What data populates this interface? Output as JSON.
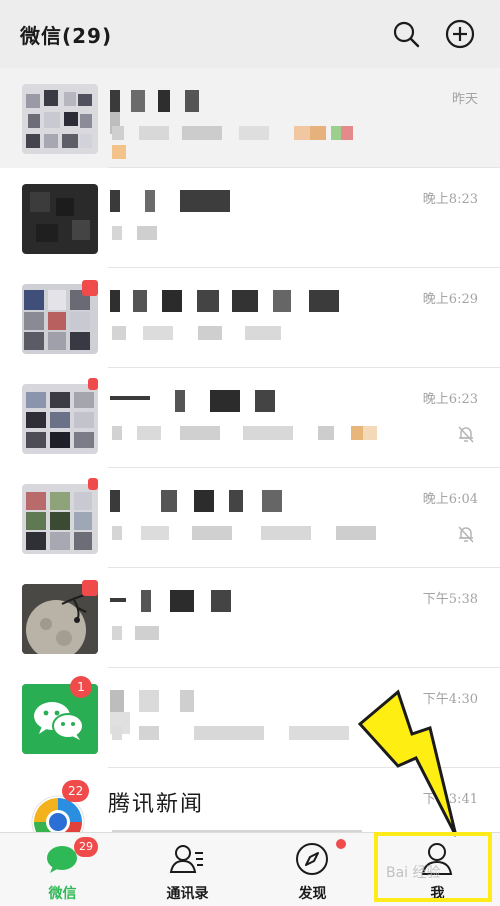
{
  "header": {
    "title": "微信(29)",
    "search_icon": "search-icon",
    "add_icon": "plus-circle-icon"
  },
  "chats": [
    {
      "time": "昨天",
      "pinned": true,
      "muted": false
    },
    {
      "time": "晚上8:23",
      "pinned": false,
      "muted": false
    },
    {
      "time": "晚上6:29",
      "pinned": false,
      "muted": false
    },
    {
      "time": "晚上6:23",
      "pinned": false,
      "muted": true
    },
    {
      "time": "晚上6:04",
      "pinned": false,
      "muted": true
    },
    {
      "time": "下午5:38",
      "pinned": false,
      "muted": false
    },
    {
      "time": "下午4:30",
      "pinned": false,
      "muted": false,
      "badge": "1"
    },
    {
      "time": "下午3:41",
      "pinned": false,
      "muted": false,
      "badge": "22",
      "name": "腾讯新闻"
    }
  ],
  "tabbar": {
    "tabs": [
      {
        "label": "微信",
        "icon": "chat-bubble-icon",
        "badge": "29",
        "active": true
      },
      {
        "label": "通讯录",
        "icon": "contacts-icon"
      },
      {
        "label": "发现",
        "icon": "compass-icon",
        "dot": true
      },
      {
        "label": "我",
        "icon": "person-icon"
      }
    ]
  },
  "watermark": "Bai 经验",
  "colors": {
    "accent_green": "#2fb856",
    "badge_red": "#f04b4b",
    "highlight_yellow": "#ffeb1a",
    "header_bg": "#ededed"
  }
}
